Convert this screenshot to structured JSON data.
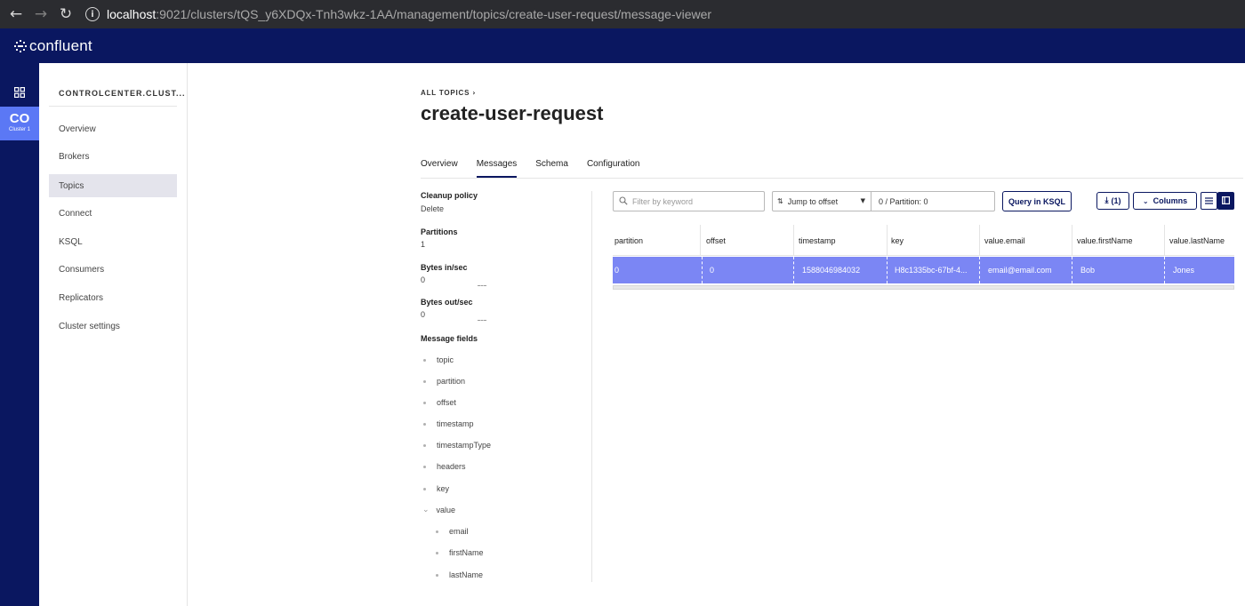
{
  "browser": {
    "url_host": "localhost",
    "url_path": ":9021/clusters/tQS_y6XDQx-Tnh3wkz-1AA/management/topics/create-user-request/message-viewer"
  },
  "header": {
    "logo_text": "confluent"
  },
  "rail": {
    "cluster_abbr": "CO",
    "cluster_sub": "Cluster 1"
  },
  "sidebar": {
    "cluster_name": "CONTROLCENTER.CLUST...",
    "items": [
      {
        "label": "Overview"
      },
      {
        "label": "Brokers"
      },
      {
        "label": "Topics",
        "active": true
      },
      {
        "label": "Connect"
      },
      {
        "label": "KSQL"
      },
      {
        "label": "Consumers"
      },
      {
        "label": "Replicators"
      },
      {
        "label": "Cluster settings"
      }
    ]
  },
  "main": {
    "breadcrumb": "ALL TOPICS",
    "title": "create-user-request",
    "tabs": [
      {
        "label": "Overview"
      },
      {
        "label": "Messages",
        "active": true
      },
      {
        "label": "Schema"
      },
      {
        "label": "Configuration"
      }
    ]
  },
  "info": {
    "cleanup_label": "Cleanup policy",
    "cleanup_value": "Delete",
    "partitions_label": "Partitions",
    "partitions_value": "1",
    "bytes_in_label": "Bytes in/sec",
    "bytes_in_value": "0",
    "bytes_out_label": "Bytes out/sec",
    "bytes_out_value": "0",
    "fields_label": "Message fields",
    "fields": [
      "topic",
      "partition",
      "offset",
      "timestamp",
      "timestampType",
      "headers",
      "key"
    ],
    "value_field": "value",
    "value_children": [
      "email",
      "firstName",
      "lastName"
    ]
  },
  "toolbar": {
    "filter_placeholder": "Filter by keyword",
    "offset_mode": "Jump to offset",
    "offset_value": "0 / Partition: 0",
    "ksql_label": "Query in KSQL",
    "download_label": "(1)",
    "columns_label": "Columns"
  },
  "table": {
    "headers": [
      "partition",
      "offset",
      "timestamp",
      "key",
      "value.email",
      "value.firstName",
      "value.lastName"
    ],
    "row": [
      "0",
      "0",
      "1588046984032",
      "H8c1335bc-67bf-4...",
      "email@email.com",
      "Bob",
      "Jones"
    ]
  },
  "colors": {
    "nav_bg": "#0a1760",
    "cluster_badge": "#5b78f5",
    "selected_row": "#7b86f4"
  }
}
